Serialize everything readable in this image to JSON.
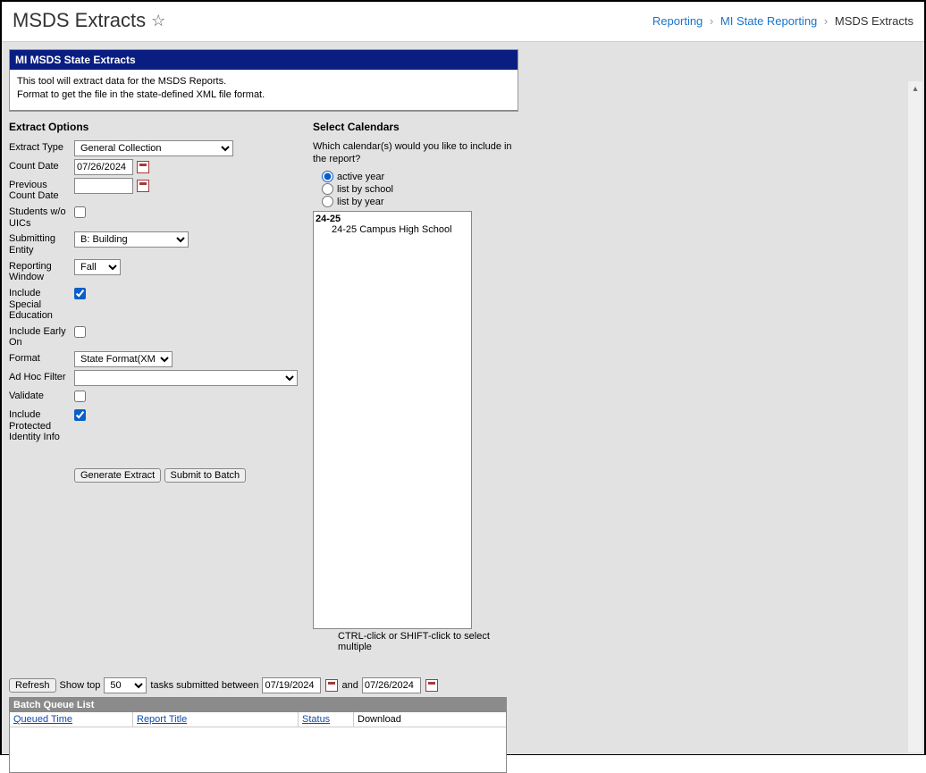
{
  "header": {
    "title": "MSDS Extracts",
    "breadcrumb": {
      "a": "Reporting",
      "b": "MI State Reporting",
      "c": "MSDS Extracts"
    }
  },
  "panel": {
    "title": "MI MSDS State Extracts",
    "line1": "This tool will extract data for the MSDS Reports.",
    "line2": "Format to get the file in the state-defined XML file format."
  },
  "sections": {
    "extract_options": "Extract Options",
    "select_calendars": "Select Calendars"
  },
  "labels": {
    "extract_type": "Extract Type",
    "count_date": "Count Date",
    "previous_count_date": "Previous Count Date",
    "students_wo_uics": "Students w/o UICs",
    "submitting_entity": "Submitting Entity",
    "reporting_window": "Reporting Window",
    "include_special_ed": "Include Special Education",
    "include_early_on": "Include Early On",
    "format": "Format",
    "ad_hoc_filter": "Ad Hoc Filter",
    "validate": "Validate",
    "include_protected": "Include Protected Identity Info"
  },
  "values": {
    "extract_type": "General Collection",
    "count_date": "07/26/2024",
    "previous_count_date": "",
    "submitting_entity": "B: Building",
    "reporting_window": "Fall",
    "format": "State Format(XML)",
    "ad_hoc_filter": ""
  },
  "buttons": {
    "generate": "Generate Extract",
    "submit": "Submit to Batch",
    "refresh": "Refresh"
  },
  "calendars": {
    "help": "Which calendar(s) would you like to include in the report?",
    "opt_active": "active year",
    "opt_school": "list by school",
    "opt_year": "list by year",
    "list_year": "24-25",
    "list_school": "24-25 Campus High School",
    "hint": "CTRL-click or SHIFT-click to select multiple"
  },
  "batch": {
    "show_top_label": "Show top",
    "show_top_value": "50",
    "between_label": "tasks submitted between",
    "date_from": "07/19/2024",
    "and_label": "and",
    "date_to": "07/26/2024",
    "list_title": "Batch Queue List",
    "col_queued": "Queued Time",
    "col_report": "Report Title",
    "col_status": "Status",
    "col_download": "Download"
  }
}
